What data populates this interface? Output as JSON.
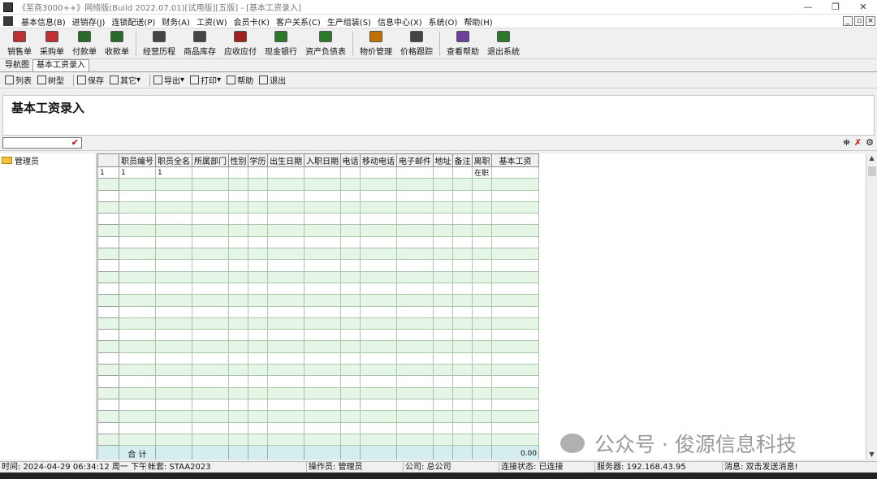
{
  "window": {
    "title": "《至商3000++》网络版(Build 2022.07.01)[试用版][五版] - [基本工资录入]",
    "min": "—",
    "restore": "❐",
    "close": "✕"
  },
  "menu": {
    "items": [
      "基本信息(B)",
      "进销存(J)",
      "连锁配送(P)",
      "财务(A)",
      "工资(W)",
      "会员卡(K)",
      "客户关系(C)",
      "生产组装(S)",
      "信息中心(X)",
      "系统(O)",
      "帮助(H)"
    ],
    "mdi_controls": [
      "_",
      "▫",
      "×"
    ]
  },
  "toolbar": {
    "items": [
      {
        "label": "销售单",
        "icon": "sales-order-icon",
        "color": "#c03030"
      },
      {
        "label": "采购单",
        "icon": "purchase-order-icon",
        "color": "#c03030"
      },
      {
        "label": "付款单",
        "icon": "payment-icon",
        "color": "#2a6a2a"
      },
      {
        "label": "收款单",
        "icon": "receipt-icon",
        "color": "#2a6a2a"
      },
      {
        "label": "经营历程",
        "icon": "history-icon",
        "color": "#444444"
      },
      {
        "label": "商品库存",
        "icon": "inventory-icon",
        "color": "#444444"
      },
      {
        "label": "应收应付",
        "icon": "receivable-icon",
        "color": "#a02020"
      },
      {
        "label": "现金银行",
        "icon": "cash-bank-icon",
        "color": "#2a7a2a"
      },
      {
        "label": "资产负债表",
        "icon": "balance-sheet-icon",
        "color": "#2a7a2a"
      },
      {
        "label": "物价管理",
        "icon": "price-mgmt-icon",
        "color": "#c07000"
      },
      {
        "label": "价格跟踪",
        "icon": "price-track-icon",
        "color": "#444444"
      },
      {
        "label": "查看帮助",
        "icon": "help-book-icon",
        "color": "#7040a0"
      },
      {
        "label": "退出系统",
        "icon": "exit-icon",
        "color": "#2a7a2a"
      }
    ]
  },
  "tabs": [
    "导航图",
    "基本工资录入"
  ],
  "subtoolbar": {
    "items": [
      "列表",
      "树型",
      "保存",
      "其它",
      "导出",
      "打印",
      "帮助",
      "退出"
    ]
  },
  "form": {
    "title": "基本工资录入"
  },
  "tree": {
    "root": "管理员"
  },
  "grid": {
    "columns": [
      "职员编号",
      "职员全名",
      "所属部门",
      "性别",
      "学历",
      "出生日期",
      "入职日期",
      "电话",
      "移动电话",
      "电子邮件",
      "地址",
      "备注",
      "离职",
      "基本工资"
    ],
    "rows": [
      [
        "1",
        "1",
        "",
        "",
        "",
        "",
        "",
        "",
        "",
        "",
        "",
        "",
        "在职",
        ""
      ]
    ],
    "row_header_first": "1",
    "sum_label": "合  计",
    "sum_value": "0.00"
  },
  "watermark": "公众号 · 俊源信息科技",
  "status": {
    "time": "时间: 2024-04-29 06:34:12 周一 下午",
    "account": "帐套: STAA2023",
    "blank": "",
    "operator": "操作员: 管理员",
    "company": "公司: 总公司",
    "connection": "连接状态: 已连接",
    "server": "服务器: 192.168.43.95",
    "message": "消息: 双击发送消息!"
  }
}
